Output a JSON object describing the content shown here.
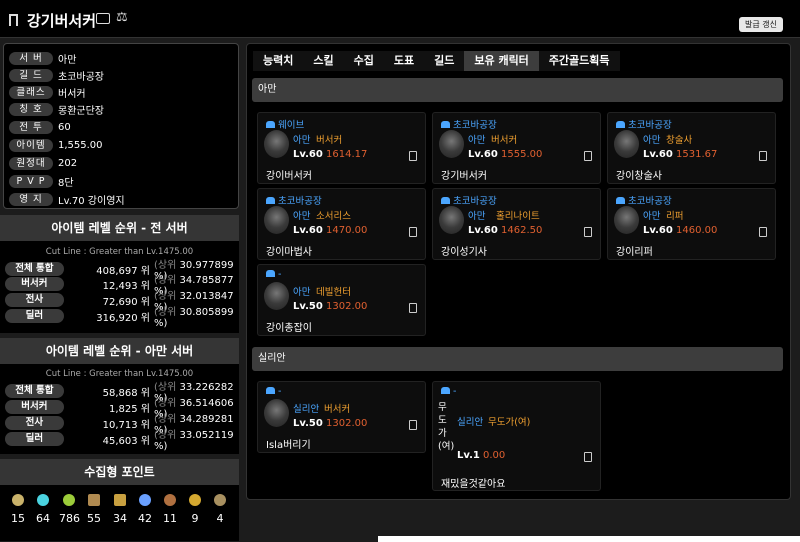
{
  "header": {
    "title": "강기버서커",
    "refresh_label": "발급 갱신"
  },
  "profile": [
    {
      "label": "서 버",
      "value": "아만"
    },
    {
      "label": "길 드",
      "value": "초코바공장"
    },
    {
      "label": "클래스",
      "value": "버서커"
    },
    {
      "label": "칭 호",
      "value": "몽환군단장"
    },
    {
      "label": "전 투",
      "value": "60"
    },
    {
      "label": "아이템",
      "value": "1,555.00"
    },
    {
      "label": "원정대",
      "value": "202"
    },
    {
      "label": "P V P",
      "value": "8단"
    },
    {
      "label": "영 지",
      "value": "Lv.70 강이영지"
    }
  ],
  "rank_all": {
    "title": "아이템 레벨 순위 - 전 서버",
    "cut": "Cut Line : Greater than Lv.1475.00",
    "rows": [
      {
        "label": "전체 통합",
        "num": "408,697 위",
        "pct": "30.977899 %)"
      },
      {
        "label": "버서커",
        "num": "12,493 위",
        "pct": "34.785877 %)"
      },
      {
        "label": "전사",
        "num": "72,690 위",
        "pct": "32.013847 %)"
      },
      {
        "label": "딜러",
        "num": "316,920 위",
        "pct": "30.805899 %)"
      }
    ]
  },
  "rank_server": {
    "title": "아이템 레벨 순위 - 아만 서버",
    "cut": "Cut Line : Greater than Lv.1475.00",
    "rows": [
      {
        "label": "전체 통합",
        "num": "58,868 위",
        "pct": "33.226282 %)"
      },
      {
        "label": "버서커",
        "num": "1,825 위",
        "pct": "36.514606 %)"
      },
      {
        "label": "전사",
        "num": "10,713 위",
        "pct": "34.289281 %)"
      },
      {
        "label": "딜러",
        "num": "45,603 위",
        "pct": "33.052119 %)"
      }
    ]
  },
  "rank_prefix": "(상위",
  "collect": {
    "title": "수집형 포인트",
    "items": [
      {
        "icon": "island-heart-icon",
        "count": "15",
        "color": "#c9b26a"
      },
      {
        "icon": "island-orb-icon",
        "count": "64",
        "color": "#4ad3e0"
      },
      {
        "icon": "mokoko-seed-icon",
        "count": "786",
        "color": "#9ccc3a"
      },
      {
        "icon": "masterpiece-icon",
        "count": "55",
        "color": "#b08a50"
      },
      {
        "icon": "ignea-token-icon",
        "count": "34",
        "color": "#c8a040"
      },
      {
        "icon": "world-tree-leaf-icon",
        "count": "42",
        "color": "#6aa0ff"
      },
      {
        "icon": "orpheus-star-icon",
        "count": "11",
        "color": "#b07040"
      },
      {
        "icon": "sea-bounty-icon",
        "count": "9",
        "color": "#d4a830"
      },
      {
        "icon": "omnium-star-icon",
        "count": "4",
        "color": "#a89060"
      }
    ]
  },
  "tabs": [
    "능력치",
    "스킬",
    "수집",
    "도표",
    "길드",
    "보유 캐릭터",
    "주간골드획득"
  ],
  "servers": [
    {
      "name": "아만"
    },
    {
      "name": "실리안"
    }
  ],
  "characters": [
    {
      "guild": "웨이브",
      "server": "아만",
      "class": "버서커",
      "lv": "Lv.60",
      "ilvl": "1614.17",
      "name": "강이버서커"
    },
    {
      "guild": "초코바공장",
      "server": "아만",
      "class": "버서커",
      "lv": "Lv.60",
      "ilvl": "1555.00",
      "name": "강기버서커"
    },
    {
      "guild": "초코바공장",
      "server": "아만",
      "class": "창술사",
      "lv": "Lv.60",
      "ilvl": "1531.67",
      "name": "강이창술사"
    },
    {
      "guild": "초코바공장",
      "server": "아만",
      "class": "소서리스",
      "lv": "Lv.60",
      "ilvl": "1470.00",
      "name": "강이마법사"
    },
    {
      "guild": "초코바공장",
      "server": "아만",
      "class": "홀리나이트",
      "lv": "Lv.60",
      "ilvl": "1462.50",
      "name": "강이성기사"
    },
    {
      "guild": "초코바공장",
      "server": "아만",
      "class": "리퍼",
      "lv": "Lv.60",
      "ilvl": "1460.00",
      "name": "강이리퍼"
    },
    {
      "guild": "-",
      "server": "아만",
      "class": "데빌헌터",
      "lv": "Lv.50",
      "ilvl": "1302.00",
      "name": "강이총잡이"
    },
    {
      "guild": "-",
      "server": "실리안",
      "class": "버서커",
      "lv": "Lv.50",
      "ilvl": "1302.00",
      "name": "Isla버리기"
    },
    {
      "guild": "-",
      "server": "실리안",
      "class": "무도가(여)",
      "lv": "Lv.1",
      "ilvl": "0.00",
      "name": "재밌을것같아요",
      "alt": "무도가(여)"
    }
  ]
}
